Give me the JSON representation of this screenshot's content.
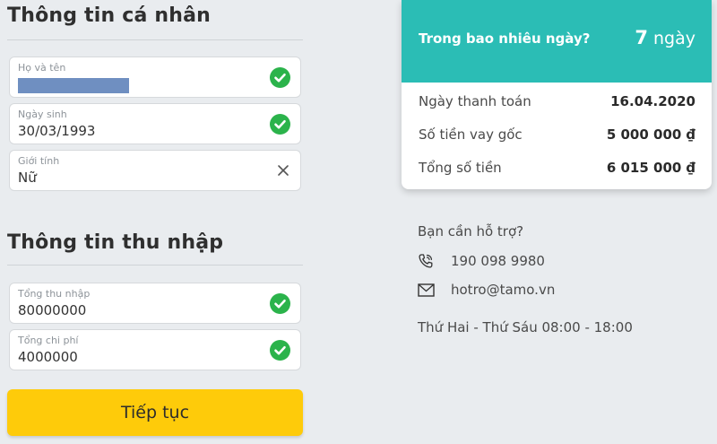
{
  "personal": {
    "title": "Thông tin cá nhân",
    "fields": [
      {
        "label": "Họ và tên",
        "value": ""
      },
      {
        "label": "Ngày sinh",
        "value": "30/03/1993"
      },
      {
        "label": "Giới tính",
        "value": "Nữ"
      }
    ]
  },
  "income": {
    "title": "Thông tin thu nhập",
    "fields": [
      {
        "label": "Tổng thu nhập",
        "value": "80000000"
      },
      {
        "label": "Tổng chi phí",
        "value": "4000000"
      }
    ]
  },
  "continue_label": "Tiếp tục",
  "summary": {
    "question": "Trong bao nhiêu ngày?",
    "days_number": "7",
    "days_unit": "ngày",
    "rows": [
      {
        "label": "Ngày thanh toán",
        "value": "16.04.2020"
      },
      {
        "label": "Số tiền vay gốc",
        "value": "5 000 000 ₫"
      },
      {
        "label": "Tổng số tiền",
        "value": "6 015 000 ₫"
      }
    ]
  },
  "support": {
    "title": "Bạn cần hỗ trợ?",
    "phone": "190 098 9980",
    "email": "hotro@tamo.vn",
    "hours": "Thứ Hai - Thứ Sáu 08:00 - 18:00"
  },
  "colors": {
    "accent": "#2bbdb5",
    "button": "#fecb0a",
    "check": "#2bb34b"
  },
  "icons": {
    "valid": "check-circle-icon",
    "clear": "close-icon",
    "phone": "phone-icon",
    "mail": "mail-icon"
  }
}
